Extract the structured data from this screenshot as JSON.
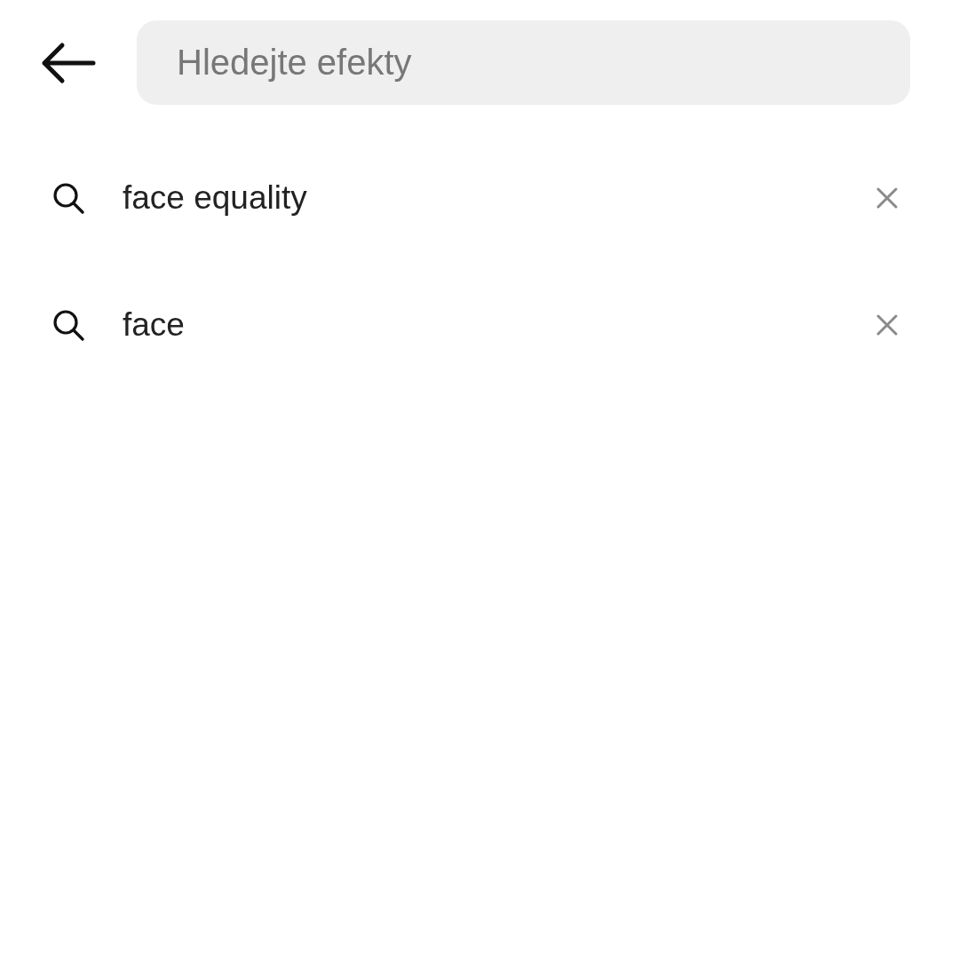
{
  "search": {
    "placeholder": "Hledejte efekty"
  },
  "recent_searches": [
    {
      "text": "face equality"
    },
    {
      "text": "face"
    }
  ]
}
